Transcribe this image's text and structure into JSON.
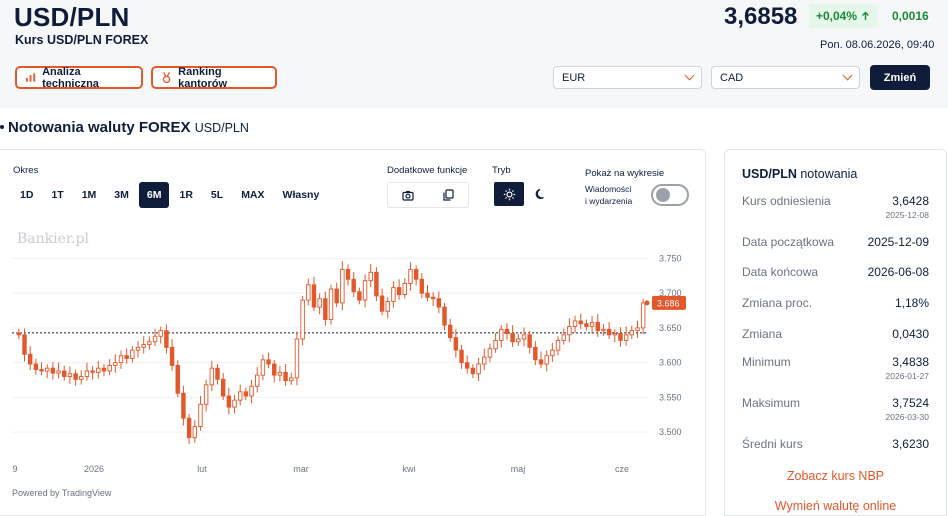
{
  "header": {
    "pair": "USD/PLN",
    "subtitle": "Kurs USD/PLN FOREX",
    "price": "3,6858",
    "pct_change": "+0,04%",
    "abs_change": "0,0016",
    "timestamp": "Pon. 08.06.2026, 09:40",
    "analiza_label": "Analiza techniczna",
    "ranking_label": "Ranking kantorów",
    "from_currency": "EUR",
    "to_currency": "CAD",
    "change_label": "Zmień"
  },
  "colors": {
    "accent": "#e2582b",
    "navy": "#0f1d3a",
    "positive": "#1a8a3a",
    "positive_bg": "#e5f6ea"
  },
  "section": {
    "title": "Notowania waluty FOREX",
    "subtitle": "USD/PLN"
  },
  "controls": {
    "okres_label": "Okres",
    "periods": [
      "1D",
      "1T",
      "1M",
      "3M",
      "6M",
      "1R",
      "5L",
      "MAX",
      "Własny"
    ],
    "active_period": "6M",
    "functions_label": "Dodatkowe funkcje",
    "mode_label": "Tryb",
    "show_label": "Pokaż na wykresie",
    "show_option_line1": "Wiadomości",
    "show_option_line2": "i wydarzenia",
    "toggle_on": false
  },
  "watermark": "Bankier.pl",
  "powered": "Powered by TradingView",
  "chart_data": {
    "type": "candlestick",
    "x_tick_labels": [
      "9",
      "2026",
      "lut",
      "mar",
      "kwi",
      "maj",
      "cze"
    ],
    "y_tick_labels": [
      "3.750",
      "3.700",
      "3.650",
      "3.600",
      "3.550",
      "3.500"
    ],
    "ylim": [
      3.48,
      3.765
    ],
    "reference_line": 3.6428,
    "last_value_label": "3.686",
    "last_value": 3.686,
    "up_color": "#ffffff",
    "down_color": "#e2582b",
    "close_series": [
      3.64,
      3.612,
      3.598,
      3.59,
      3.588,
      3.592,
      3.585,
      3.588,
      3.58,
      3.584,
      3.576,
      3.58,
      3.588,
      3.586,
      3.592,
      3.588,
      3.596,
      3.6,
      3.61,
      3.606,
      3.618,
      3.622,
      3.626,
      3.63,
      3.638,
      3.646,
      3.622,
      3.596,
      3.556,
      3.52,
      3.492,
      3.508,
      3.54,
      3.568,
      3.592,
      3.576,
      3.552,
      3.536,
      3.546,
      3.558,
      3.552,
      3.566,
      3.582,
      3.604,
      3.598,
      3.582,
      3.586,
      3.574,
      3.578,
      3.634,
      3.69,
      3.712,
      3.68,
      3.692,
      3.662,
      3.706,
      3.686,
      3.734,
      3.72,
      3.702,
      3.69,
      3.718,
      3.73,
      3.696,
      3.674,
      3.688,
      3.708,
      3.698,
      3.714,
      3.734,
      3.72,
      3.7,
      3.694,
      3.692,
      3.68,
      3.654,
      3.636,
      3.618,
      3.6,
      3.592,
      3.584,
      3.598,
      3.608,
      3.62,
      3.632,
      3.648,
      3.642,
      3.63,
      3.634,
      3.64,
      3.622,
      3.604,
      3.598,
      3.61,
      3.618,
      3.632,
      3.64,
      3.652,
      3.66,
      3.656,
      3.652,
      3.658,
      3.646,
      3.648,
      3.64,
      3.642,
      3.632,
      3.64,
      3.646,
      3.65,
      3.686
    ]
  },
  "stats": {
    "title_pair": "USD/PLN",
    "title_suffix": "notowania",
    "rows": [
      {
        "label": "Kurs odniesienia",
        "value": "3,6428",
        "date": "2025-12-08"
      },
      {
        "label": "Data początkowa",
        "value": "2025-12-09",
        "date": ""
      },
      {
        "label": "Data końcowa",
        "value": "2026-06-08",
        "date": ""
      },
      {
        "label": "Zmiana proc.",
        "value": "1,18%",
        "date": ""
      },
      {
        "label": "Zmiana",
        "value": "0,0430",
        "date": ""
      },
      {
        "label": "Minimum",
        "value": "3,4838",
        "date": "2026-01-27"
      },
      {
        "label": "Maksimum",
        "value": "3,7524",
        "date": "2026-03-30"
      },
      {
        "label": "Średni kurs",
        "value": "3,6230",
        "date": ""
      }
    ],
    "link_nbp": "Zobacz kurs NBP",
    "link_exchange": "Wymień walutę online"
  }
}
